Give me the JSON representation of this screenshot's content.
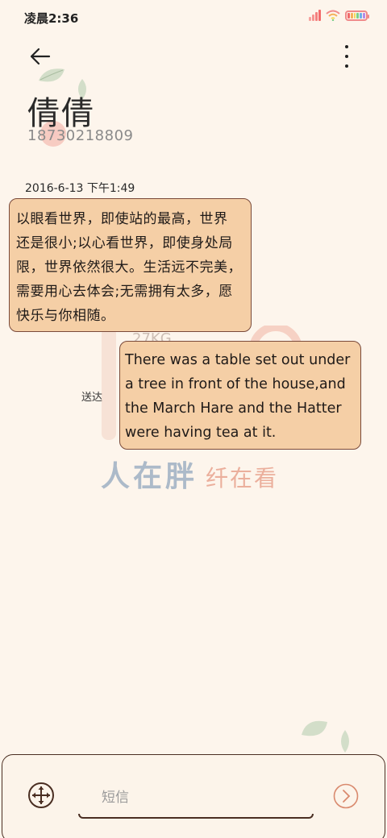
{
  "status_bar": {
    "time": "凌晨2:36",
    "signal_color": "#f26b6b",
    "battery_colors": [
      "#f06a6a",
      "#f5b25c",
      "#f3d85a",
      "#7ccf8a",
      "#6fb0e8",
      "#b68be8"
    ]
  },
  "header": {
    "back_icon": "arrow-left-icon",
    "more_icon": "more-vertical-icon",
    "contact_name": "倩倩",
    "contact_number": "18730218809"
  },
  "conversation": {
    "timestamp": "2016-6-13 下午1:49",
    "incoming_message": {
      "lines": [
        "以眼看世界，即使站的最高，世界",
        "还是很小;以心看世界，即使身处局",
        "限，世界依然很大。生活远不完美，",
        "需要用心去体会;无需拥有太多，愿",
        "快乐与你相随。"
      ]
    },
    "outgoing_message": {
      "lines": [
        "There was a table set out under",
        "a tree in front of the house,and",
        "the March Hare and the Hatter",
        "were having tea at it."
      ]
    },
    "sent_status": "送达"
  },
  "wallpaper": {
    "watermark_main": "人在胖",
    "watermark_sub": "纤在看",
    "accent_bubble": "#f5cfa6",
    "border_color": "#7a4a3a"
  },
  "composer": {
    "attach_icon": "move-cross-icon",
    "placeholder": "短信",
    "value": "",
    "send_icon": "chevron-right-circle-icon"
  }
}
